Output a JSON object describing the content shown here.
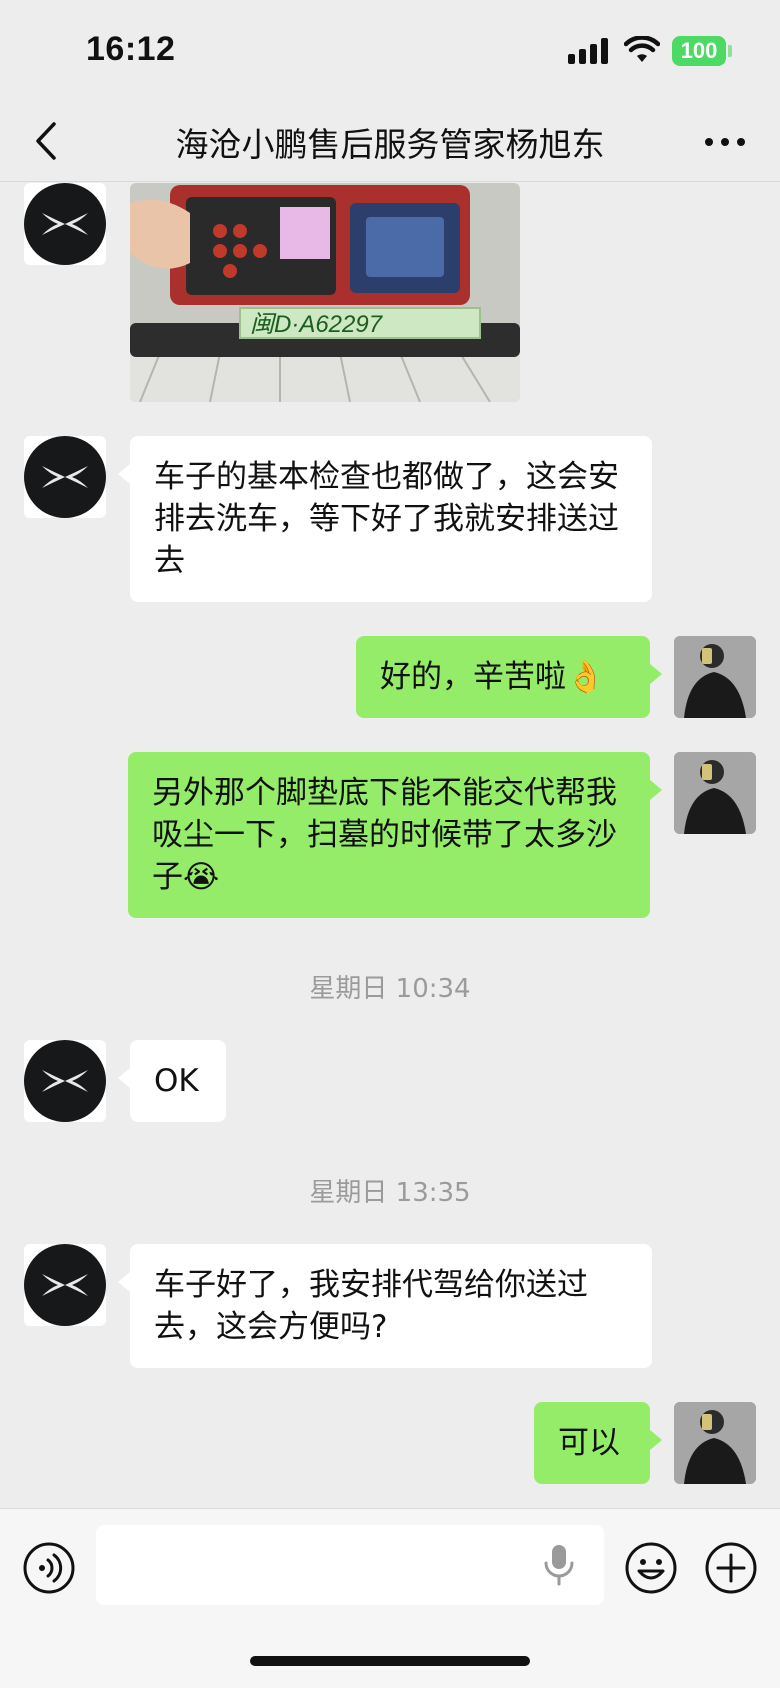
{
  "status_bar": {
    "time": "16:12",
    "battery": "100"
  },
  "nav": {
    "title": "海沧小鹏售后服务管家杨旭东"
  },
  "messages": [
    {
      "side": "left",
      "type": "image",
      "plate_text": "闽D·A62297"
    },
    {
      "side": "left",
      "type": "text",
      "text": "车子的基本检查也都做了，这会安排去洗车，等下好了我就安排送过去"
    },
    {
      "side": "right",
      "type": "text",
      "text": "好的，辛苦啦👌"
    },
    {
      "side": "right",
      "type": "text",
      "text": "另外那个脚垫底下能不能交代帮我吸尘一下，扫墓的时候带了太多沙子😭"
    },
    {
      "type": "timestamp",
      "text": "星期日 10:34"
    },
    {
      "side": "left",
      "type": "text",
      "text": "OK"
    },
    {
      "type": "timestamp",
      "text": "星期日 13:35"
    },
    {
      "side": "left",
      "type": "text",
      "text": "车子好了，我安排代驾给你送过去，这会方便吗?"
    },
    {
      "side": "right",
      "type": "text",
      "text": "可以"
    }
  ],
  "icons": {
    "back": "chevron-left-icon",
    "more": "more-dots-icon",
    "voice": "voice-icon",
    "mic": "microphone-icon",
    "emoji": "emoji-icon",
    "plus": "plus-icon"
  },
  "colors": {
    "background": "#ededed",
    "bubble_self": "#95ec69",
    "bubble_other": "#ffffff",
    "battery": "#4cd964"
  }
}
